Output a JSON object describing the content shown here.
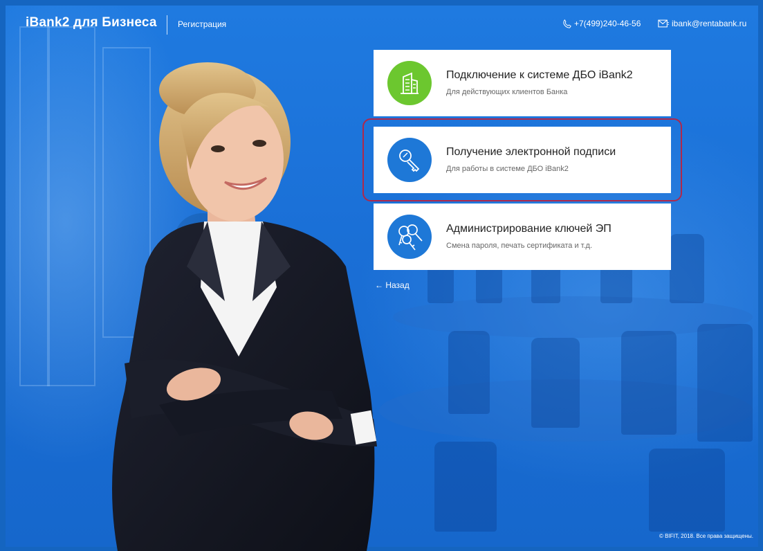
{
  "header": {
    "brand": "iBank2 для Бизнеса",
    "section": "Регистрация",
    "phone": "+7(499)240-46-56",
    "email": "ibank@rentabank.ru",
    "phone_icon": "phone-icon",
    "email_icon": "mail-icon"
  },
  "cards": [
    {
      "title": "Подключение к системе ДБО iBank2",
      "subtitle": "Для действующих клиентов Банка",
      "icon": "building-icon",
      "color": "#6cc72f"
    },
    {
      "title": "Получение электронной подписи",
      "subtitle": "Для работы в системе ДБО iBank2",
      "icon": "key-icon",
      "color": "#1e78d7"
    },
    {
      "title": "Администрирование ключей ЭП",
      "subtitle": "Смена пароля, печать сертификата и т.д.",
      "icon": "keys-icon",
      "color": "#1e78d7"
    }
  ],
  "back_label": "← Назад",
  "footer": "© BIFIT, 2018. Все права защищены.",
  "colors": {
    "background": "#1a6fd6",
    "highlight": "#b0284a"
  }
}
